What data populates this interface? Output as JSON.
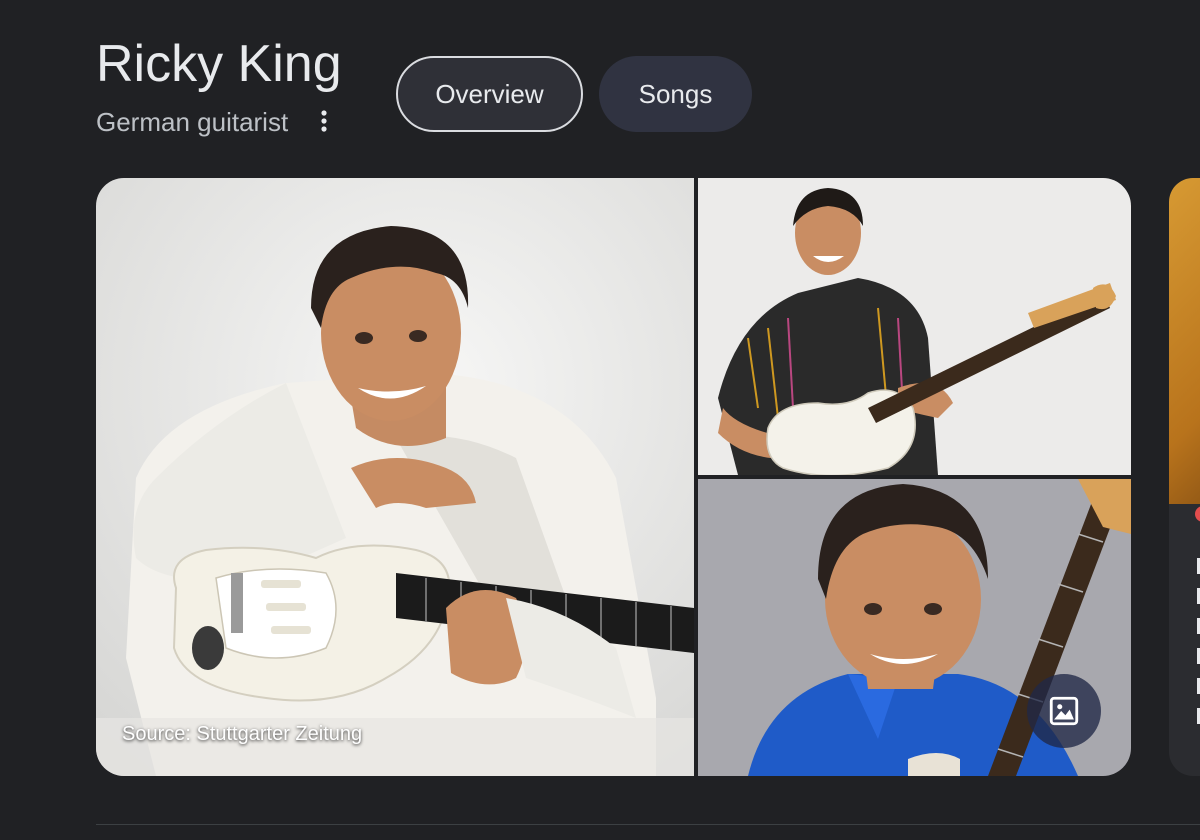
{
  "entity": {
    "name": "Ricky King",
    "description": "German guitarist"
  },
  "tabs": [
    {
      "label": "Overview",
      "selected": true
    },
    {
      "label": "Songs",
      "selected": false
    }
  ],
  "gallery": {
    "source_label": "Source: Stuttgarter Zeitung",
    "more_images_icon": "image-icon"
  },
  "colors": {
    "background": "#202124",
    "primary_text": "#e8eaed",
    "secondary_text": "#bdc1c6",
    "tab_fill": "#303341"
  }
}
